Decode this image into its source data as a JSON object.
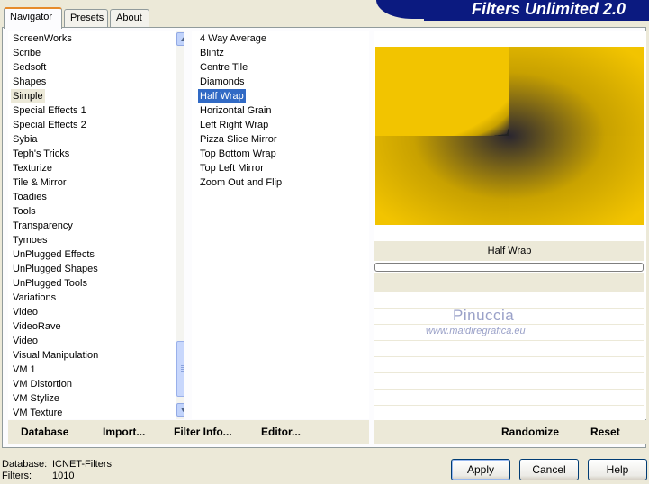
{
  "tabs": [
    {
      "label": "Navigator",
      "active": true
    },
    {
      "label": "Presets",
      "active": false
    },
    {
      "label": "About",
      "active": false
    }
  ],
  "brand": "Filters Unlimited 2.0",
  "categories": [
    "ScreenWorks",
    "Scribe",
    "Sedsoft",
    "Shapes",
    "Simple",
    "Special Effects 1",
    "Special Effects 2",
    "Sybia",
    "Teph's Tricks",
    "Texturize",
    "Tile & Mirror",
    "Toadies",
    "Tools",
    "Transparency",
    "Tymoes",
    "UnPlugged Effects",
    "UnPlugged Shapes",
    "UnPlugged Tools",
    "Variations",
    "Video",
    "VideoRave",
    "Video",
    "Visual Manipulation",
    "VM 1",
    "VM Distortion",
    "VM Stylize",
    "VM Texture"
  ],
  "selected_category": "Simple",
  "filters": [
    "4 Way Average",
    "Blintz",
    "Centre Tile",
    "Diamonds",
    "Half Wrap",
    "Horizontal Grain",
    "Left Right Wrap",
    "Pizza Slice Mirror",
    "Top Bottom Wrap",
    "Top Left Mirror",
    "Zoom Out and Flip"
  ],
  "selected_filter": "Half Wrap",
  "preview": {
    "filter_name": "Half Wrap",
    "colors": {
      "yellow": "#f2c400",
      "dark": "#2a2630"
    }
  },
  "watermark": {
    "name": "Pinuccia",
    "url": "www.maidiregrafica.eu"
  },
  "left_toolbar": [
    "Database",
    "Import...",
    "Filter Info...",
    "Editor..."
  ],
  "right_toolbar": [
    "Randomize",
    "Reset"
  ],
  "status": {
    "database_label": "Database:",
    "database_value": "ICNET-Filters",
    "filters_label": "Filters:",
    "filters_value": "1010"
  },
  "dialog_buttons": {
    "apply": "Apply",
    "cancel": "Cancel",
    "help": "Help"
  }
}
